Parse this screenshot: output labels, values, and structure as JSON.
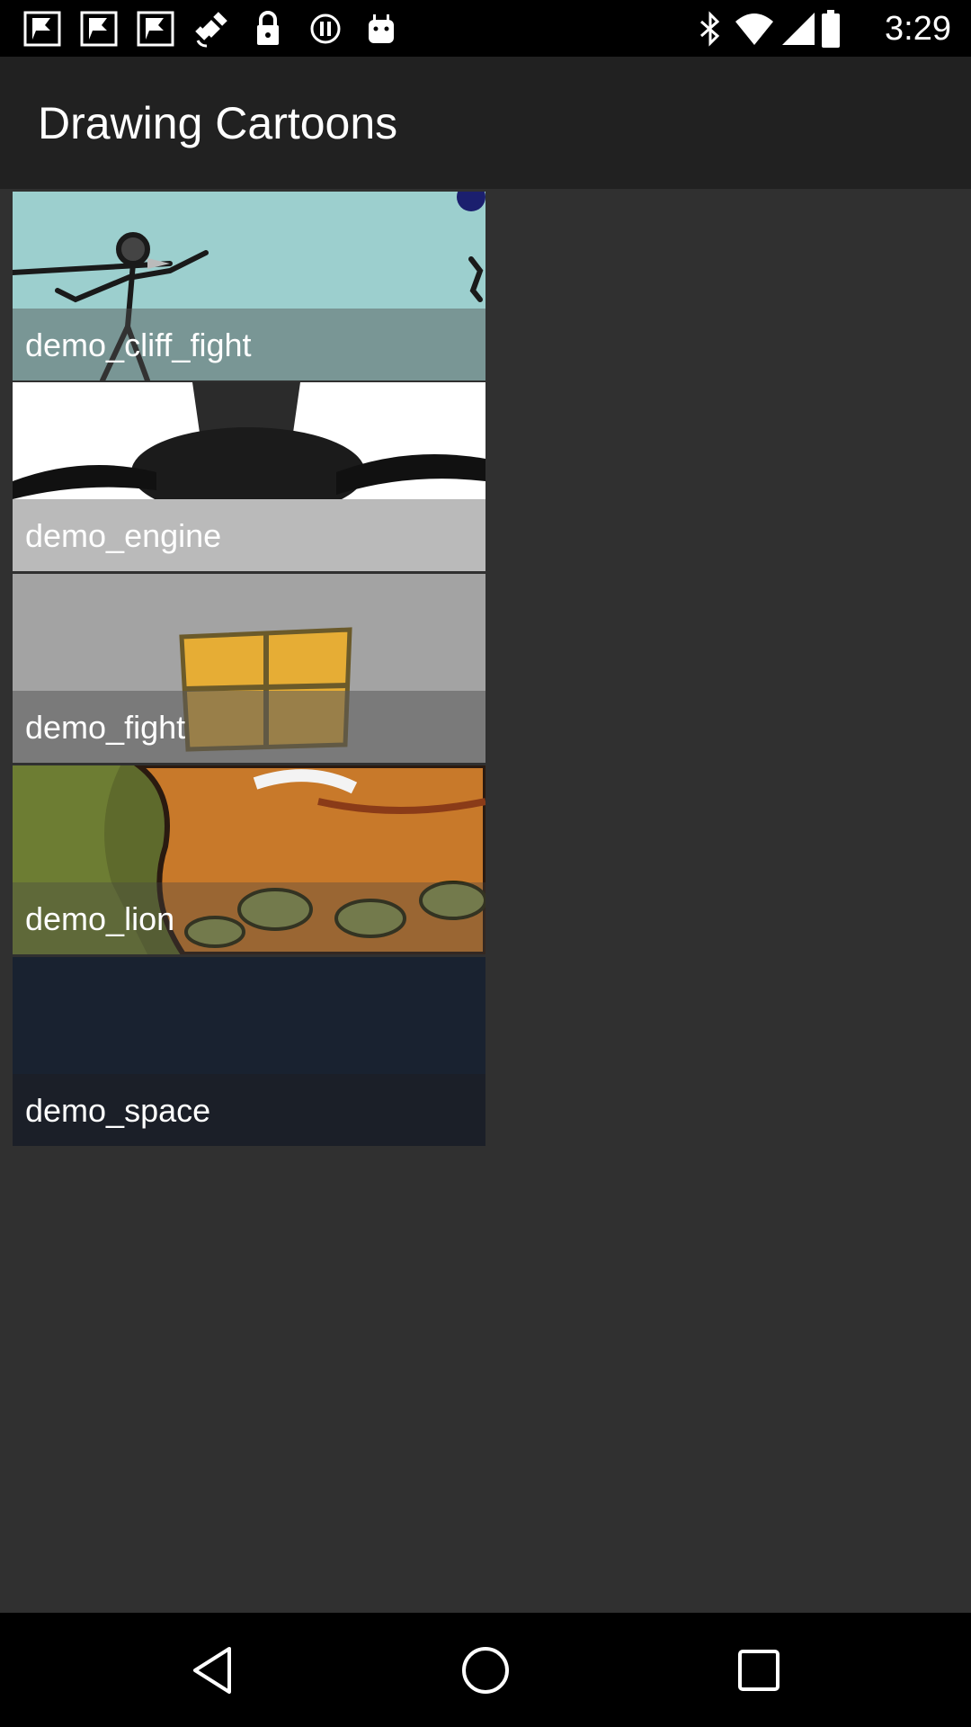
{
  "status_bar": {
    "time": "3:29",
    "icons": [
      "notification-flag-icon",
      "notification-flag-icon",
      "notification-flag-icon",
      "fake-gps-satellite-icon",
      "lock-icon",
      "alert-circle-icon",
      "android-icon",
      "bluetooth-icon",
      "wifi-icon",
      "cellular-signal-icon",
      "battery-icon"
    ]
  },
  "app_bar": {
    "title": "Drawing Cartoons"
  },
  "items": [
    {
      "label": "demo_cliff_fight"
    },
    {
      "label": "demo_engine"
    },
    {
      "label": "demo_fight"
    },
    {
      "label": "demo_lion"
    },
    {
      "label": "demo_space"
    }
  ],
  "nav_bar": {
    "buttons": [
      "back-icon",
      "home-icon",
      "recents-icon"
    ]
  }
}
